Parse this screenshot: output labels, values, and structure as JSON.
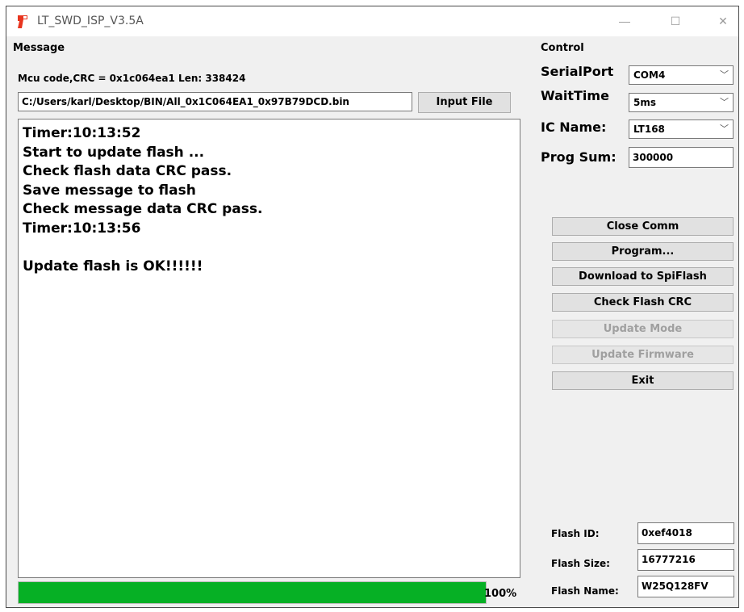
{
  "window": {
    "title": "LT_SWD_ISP_V3.5A",
    "controls": {
      "minimize": "—",
      "maximize": "☐",
      "close": "✕"
    }
  },
  "message": {
    "group_label": "Message",
    "info_line": "Mcu code,CRC = 0x1c064ea1  Len: 338424",
    "file_path": "C:/Users/karl/Desktop/BIN/All_0x1C064EA1_0x97B79DCD.bin",
    "input_file_label": "Input File",
    "log_lines": [
      "Timer:10:13:52",
      "Start to update flash ...",
      "Check flash data CRC pass.",
      "Save message to flash",
      "Check message data CRC pass.",
      "Timer:10:13:56",
      "",
      "Update flash is OK!!!!!!"
    ],
    "progress_value": 100,
    "progress_text": "100%"
  },
  "control": {
    "group_label": "Control",
    "serial_port": {
      "label": "SerialPort",
      "value": "COM4"
    },
    "wait_time": {
      "label": "WaitTime",
      "value": "5ms"
    },
    "ic_name": {
      "label": "IC Name:",
      "value": "LT168"
    },
    "prog_sum": {
      "label": "Prog Sum:",
      "value": "300000"
    },
    "buttons": {
      "close_comm": "Close Comm",
      "program": "Program...",
      "download": "Download to SpiFlash",
      "check_crc": "Check Flash CRC",
      "update_mode": "Update Mode",
      "update_firmware": "Update Firmware",
      "exit": "Exit"
    },
    "flash_id": {
      "label": "Flash ID:",
      "value": "0xef4018"
    },
    "flash_size": {
      "label": "Flash Size:",
      "value": "16777216"
    },
    "flash_name": {
      "label": "Flash Name:",
      "value": "W25Q128FV"
    }
  },
  "colors": {
    "progress_fill": "#06b025",
    "app_icon": "#e8351f"
  },
  "icons": {
    "app": "app-logo-icon",
    "dropdown": "chevron-down-icon"
  }
}
